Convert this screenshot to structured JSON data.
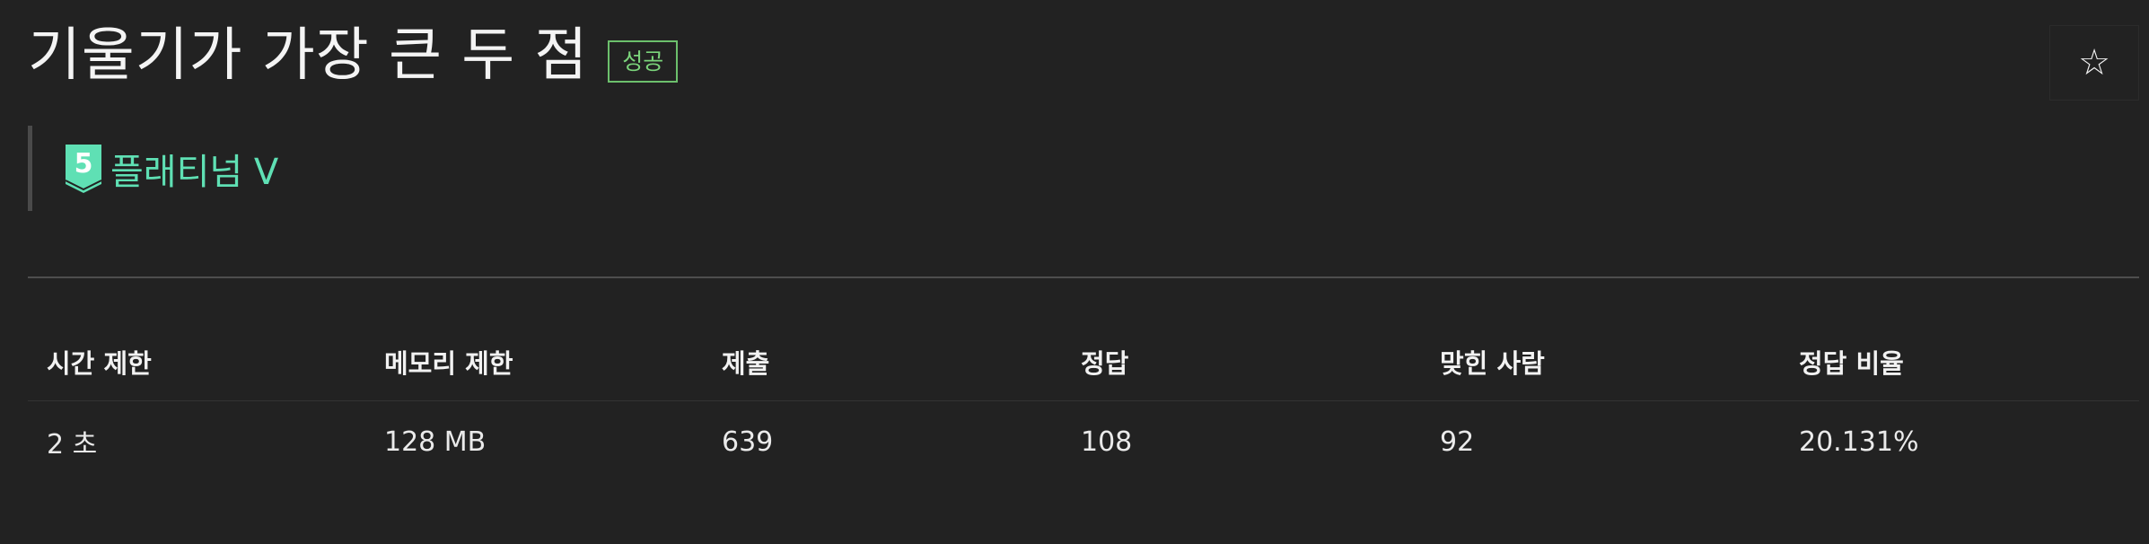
{
  "problem": {
    "title": "기울기가 가장 큰 두 점",
    "status_badge": "성공",
    "tier": {
      "label": "플래티넘 V",
      "level": "5",
      "color": "#5fe0b4"
    }
  },
  "actions": {
    "favorite_icon": "star-icon",
    "favorite_glyph": "☆"
  },
  "stats": {
    "headers": [
      "시간 제한",
      "메모리 제한",
      "제출",
      "정답",
      "맞힌 사람",
      "정답 비율"
    ],
    "values": [
      "2 초",
      "128 MB",
      "639",
      "108",
      "92",
      "20.131%"
    ]
  },
  "colors": {
    "background": "#222222",
    "success": "#7bd47b",
    "tier": "#5fe0b4"
  }
}
